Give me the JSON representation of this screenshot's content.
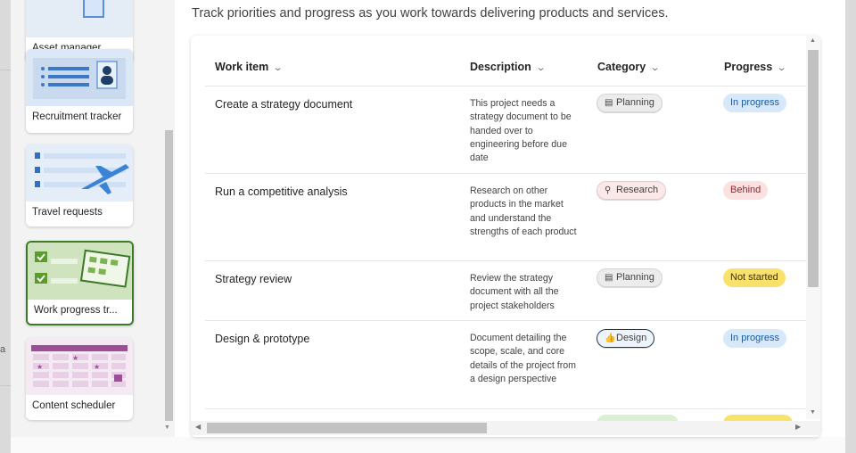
{
  "templates": [
    {
      "label": "Asset manager"
    },
    {
      "label": "Recruitment tracker"
    },
    {
      "label": "Travel requests"
    },
    {
      "label": "Work progress tr...",
      "selected": true
    },
    {
      "label": "Content scheduler"
    }
  ],
  "subtitle": "Track priorities and progress as you work towards delivering products and services.",
  "grid": {
    "columns": [
      "Work item",
      "Description",
      "Category",
      "Progress"
    ],
    "rows": [
      {
        "title": "Create a strategy document",
        "description": "This project needs a strategy document to be handed over to engineering before due date",
        "category": "Planning",
        "category_icon": "calendar-icon",
        "progress": "In progress"
      },
      {
        "title": "Run a competitive analysis",
        "description": "Research on other products in the market and understand the strengths of each product",
        "category": "Research",
        "category_icon": "people-search-icon",
        "progress": "Behind"
      },
      {
        "title": "Strategy review",
        "description": "Review the strategy document with all the project stakeholders",
        "category": "Planning",
        "category_icon": "calendar-icon",
        "progress": "Not started"
      },
      {
        "title": "Design & prototype",
        "description": "Document detailing the scope, scale, and core details of the project from a design perspective",
        "category": "Design",
        "category_icon": "thumbs-up-icon",
        "progress": "In progress"
      }
    ]
  },
  "colors": {
    "selected_border": "#3c7a28",
    "in_progress": "#d6e8fa",
    "behind": "#fbe1e1",
    "not_started": "#f9e16b"
  }
}
